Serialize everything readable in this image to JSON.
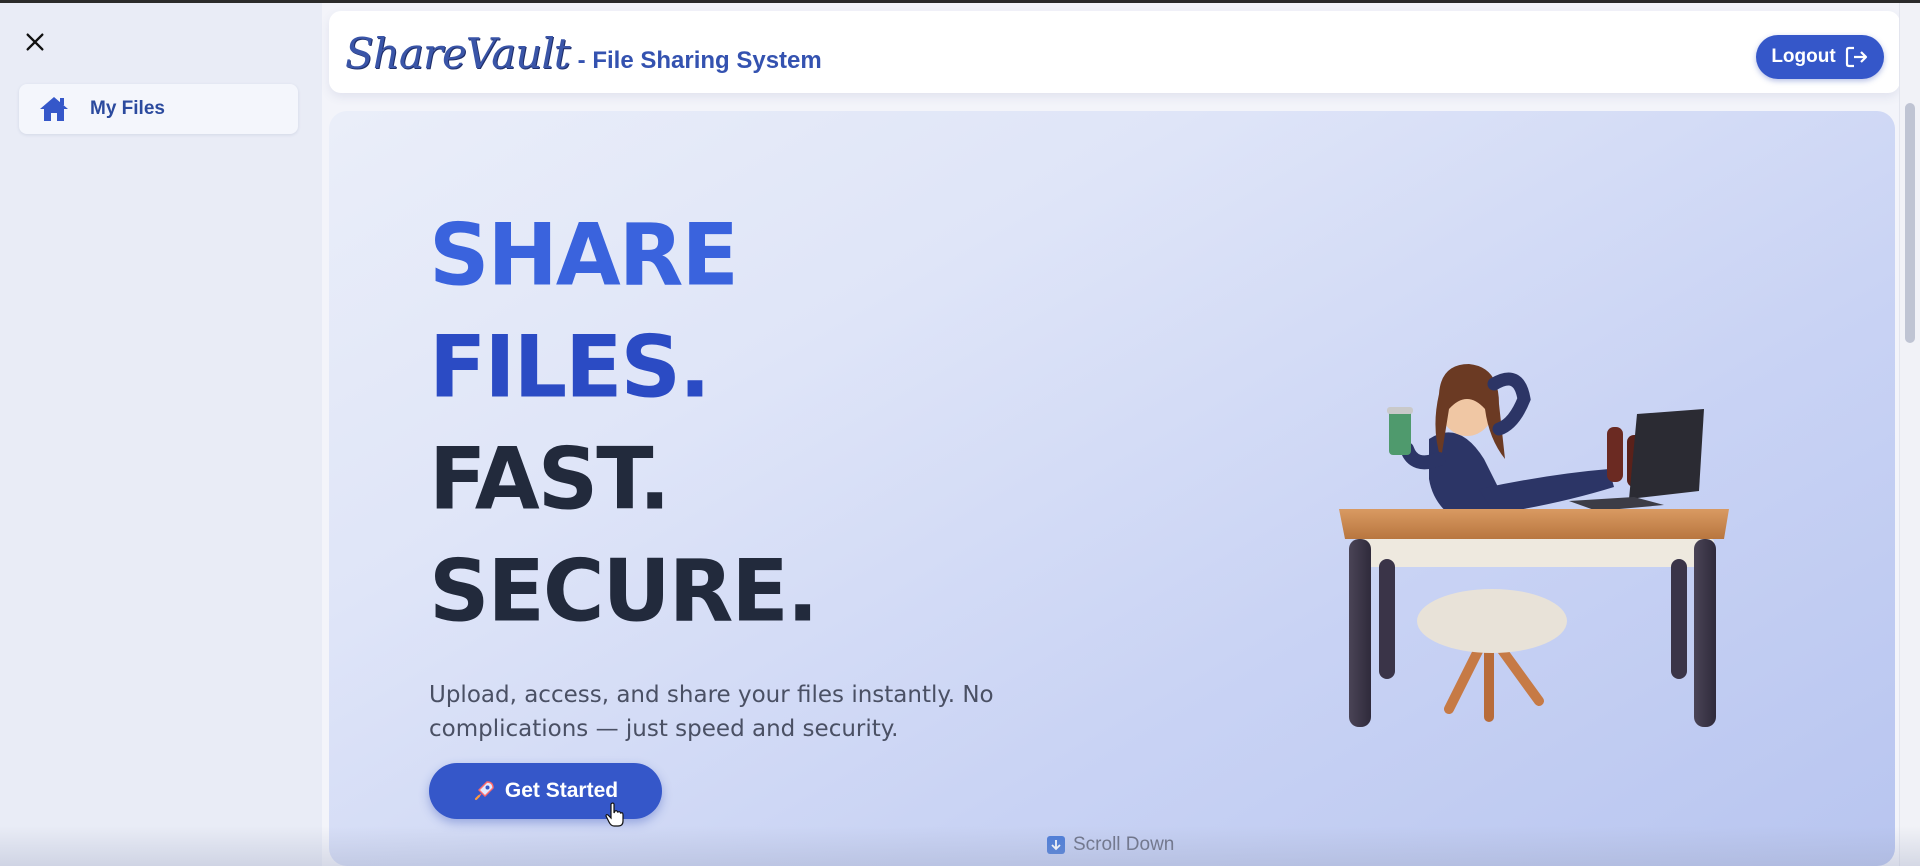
{
  "sidebar": {
    "close_icon": "close-icon",
    "items": [
      {
        "label": "My Files",
        "icon": "home-icon"
      }
    ]
  },
  "header": {
    "logo_text": "ShareVault",
    "title": "- File Sharing System",
    "logout_label": "Logout",
    "logout_icon": "logout-icon"
  },
  "hero": {
    "headline_lines": [
      "SHARE",
      "FILES.",
      "FAST.",
      "SECURE."
    ],
    "subtext": "Upload, access, and share your files instantly. No complications — just speed and security.",
    "cta_label": "Get Started",
    "cta_icon": "rocket-icon",
    "illustration": "person-at-desk-illustration",
    "scroll_label": "Scroll Down",
    "scroll_icon": "arrow-down-icon"
  },
  "colors": {
    "brand_blue": "#3557c9",
    "headline_blue_1": "#3a63dd",
    "headline_blue_2": "#2b4bc4",
    "headline_dark": "#222a3c"
  }
}
